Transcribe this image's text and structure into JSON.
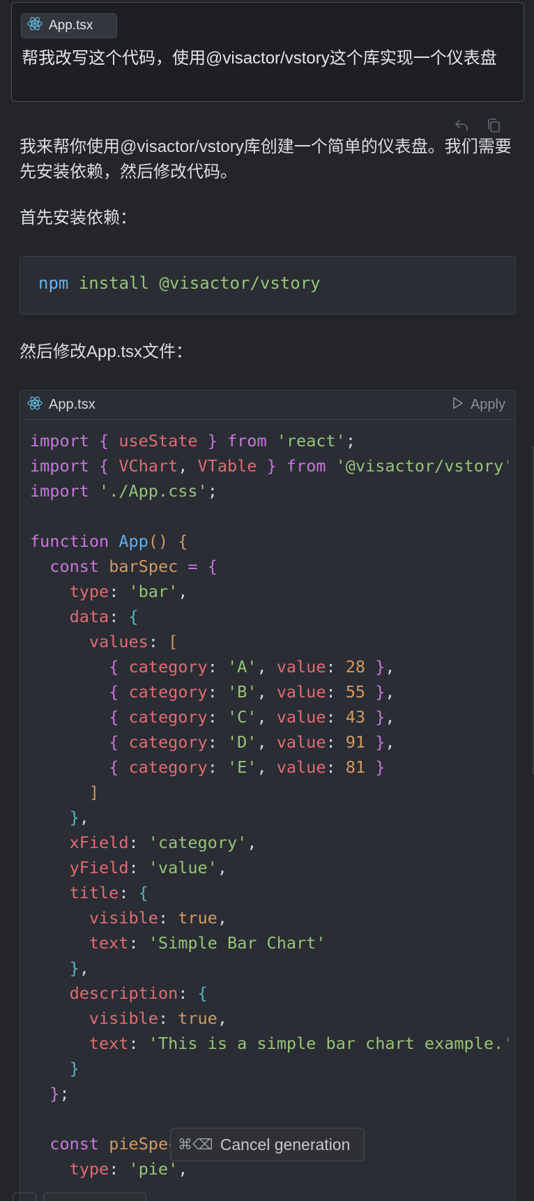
{
  "user_message": {
    "file_chip": {
      "icon": "react-icon",
      "label": "App.tsx"
    },
    "text": "帮我改写这个代码，使用@visactor/vstory这个库实现一个仪表盘"
  },
  "message_actions": {
    "icons": [
      "undo-icon",
      "copy-icon"
    ]
  },
  "response": {
    "intro": "我来帮你使用@visactor/vstory库创建一个简单的仪表盘。我们需要先安装依赖，然后修改代码。",
    "step1": "首先安装依赖：",
    "install_cmd": {
      "command": "npm",
      "args": "install @visactor/vstory"
    },
    "step2": "然后修改App.tsx文件："
  },
  "code_block": {
    "file_label": "App.tsx",
    "file_icon": "react-icon",
    "apply_label": "Apply",
    "apply_icon": "play-icon",
    "lines": [
      [
        [
          "k",
          "import"
        ],
        [
          "p",
          " "
        ],
        [
          "bp",
          "{"
        ],
        [
          "p",
          " "
        ],
        [
          "v",
          "useState"
        ],
        [
          "p",
          " "
        ],
        [
          "bp",
          "}"
        ],
        [
          "p",
          " "
        ],
        [
          "k",
          "from"
        ],
        [
          "p",
          " "
        ],
        [
          "s",
          "'react'"
        ],
        [
          "p",
          ";"
        ]
      ],
      [
        [
          "k",
          "import"
        ],
        [
          "p",
          " "
        ],
        [
          "bp",
          "{"
        ],
        [
          "p",
          " "
        ],
        [
          "v",
          "VChart"
        ],
        [
          "p",
          ", "
        ],
        [
          "v",
          "VTable"
        ],
        [
          "p",
          " "
        ],
        [
          "bp",
          "}"
        ],
        [
          "p",
          " "
        ],
        [
          "k",
          "from"
        ],
        [
          "p",
          " "
        ],
        [
          "s",
          "'@visactor/vstory'"
        ],
        [
          "p",
          ";"
        ]
      ],
      [
        [
          "k",
          "import"
        ],
        [
          "p",
          " "
        ],
        [
          "s",
          "'./App.css'"
        ],
        [
          "p",
          ";"
        ]
      ],
      [],
      [
        [
          "k",
          "function"
        ],
        [
          "p",
          " "
        ],
        [
          "f",
          "App"
        ],
        [
          "b",
          "()"
        ],
        [
          "p",
          " "
        ],
        [
          "b",
          "{"
        ]
      ],
      [
        [
          "p",
          "  "
        ],
        [
          "k",
          "const"
        ],
        [
          "p",
          " "
        ],
        [
          "n",
          "barSpec"
        ],
        [
          "p",
          " "
        ],
        [
          "k",
          "="
        ],
        [
          "p",
          " "
        ],
        [
          "bp",
          "{"
        ]
      ],
      [
        [
          "p",
          "    "
        ],
        [
          "v",
          "type"
        ],
        [
          "p",
          ": "
        ],
        [
          "s",
          "'bar'"
        ],
        [
          "p",
          ","
        ]
      ],
      [
        [
          "p",
          "    "
        ],
        [
          "v",
          "data"
        ],
        [
          "p",
          ": "
        ],
        [
          "bc",
          "{"
        ]
      ],
      [
        [
          "p",
          "      "
        ],
        [
          "v",
          "values"
        ],
        [
          "p",
          ": "
        ],
        [
          "b",
          "["
        ]
      ],
      [
        [
          "p",
          "        "
        ],
        [
          "bp",
          "{"
        ],
        [
          "p",
          " "
        ],
        [
          "v",
          "category"
        ],
        [
          "p",
          ": "
        ],
        [
          "s",
          "'A'"
        ],
        [
          "p",
          ", "
        ],
        [
          "v",
          "value"
        ],
        [
          "p",
          ": "
        ],
        [
          "n",
          "28"
        ],
        [
          "p",
          " "
        ],
        [
          "bp",
          "}"
        ],
        [
          "p",
          ","
        ]
      ],
      [
        [
          "p",
          "        "
        ],
        [
          "bp",
          "{"
        ],
        [
          "p",
          " "
        ],
        [
          "v",
          "category"
        ],
        [
          "p",
          ": "
        ],
        [
          "s",
          "'B'"
        ],
        [
          "p",
          ", "
        ],
        [
          "v",
          "value"
        ],
        [
          "p",
          ": "
        ],
        [
          "n",
          "55"
        ],
        [
          "p",
          " "
        ],
        [
          "bp",
          "}"
        ],
        [
          "p",
          ","
        ]
      ],
      [
        [
          "p",
          "        "
        ],
        [
          "bp",
          "{"
        ],
        [
          "p",
          " "
        ],
        [
          "v",
          "category"
        ],
        [
          "p",
          ": "
        ],
        [
          "s",
          "'C'"
        ],
        [
          "p",
          ", "
        ],
        [
          "v",
          "value"
        ],
        [
          "p",
          ": "
        ],
        [
          "n",
          "43"
        ],
        [
          "p",
          " "
        ],
        [
          "bp",
          "}"
        ],
        [
          "p",
          ","
        ]
      ],
      [
        [
          "p",
          "        "
        ],
        [
          "bp",
          "{"
        ],
        [
          "p",
          " "
        ],
        [
          "v",
          "category"
        ],
        [
          "p",
          ": "
        ],
        [
          "s",
          "'D'"
        ],
        [
          "p",
          ", "
        ],
        [
          "v",
          "value"
        ],
        [
          "p",
          ": "
        ],
        [
          "n",
          "91"
        ],
        [
          "p",
          " "
        ],
        [
          "bp",
          "}"
        ],
        [
          "p",
          ","
        ]
      ],
      [
        [
          "p",
          "        "
        ],
        [
          "bp",
          "{"
        ],
        [
          "p",
          " "
        ],
        [
          "v",
          "category"
        ],
        [
          "p",
          ": "
        ],
        [
          "s",
          "'E'"
        ],
        [
          "p",
          ", "
        ],
        [
          "v",
          "value"
        ],
        [
          "p",
          ": "
        ],
        [
          "n",
          "81"
        ],
        [
          "p",
          " "
        ],
        [
          "bp",
          "}"
        ]
      ],
      [
        [
          "p",
          "      "
        ],
        [
          "b",
          "]"
        ]
      ],
      [
        [
          "p",
          "    "
        ],
        [
          "bc",
          "}"
        ],
        [
          "p",
          ","
        ]
      ],
      [
        [
          "p",
          "    "
        ],
        [
          "v",
          "xField"
        ],
        [
          "p",
          ": "
        ],
        [
          "s",
          "'category'"
        ],
        [
          "p",
          ","
        ]
      ],
      [
        [
          "p",
          "    "
        ],
        [
          "v",
          "yField"
        ],
        [
          "p",
          ": "
        ],
        [
          "s",
          "'value'"
        ],
        [
          "p",
          ","
        ]
      ],
      [
        [
          "p",
          "    "
        ],
        [
          "v",
          "title"
        ],
        [
          "p",
          ": "
        ],
        [
          "bc",
          "{"
        ]
      ],
      [
        [
          "p",
          "      "
        ],
        [
          "v",
          "visible"
        ],
        [
          "p",
          ": "
        ],
        [
          "n",
          "true"
        ],
        [
          "p",
          ","
        ]
      ],
      [
        [
          "p",
          "      "
        ],
        [
          "v",
          "text"
        ],
        [
          "p",
          ": "
        ],
        [
          "s",
          "'Simple Bar Chart'"
        ]
      ],
      [
        [
          "p",
          "    "
        ],
        [
          "bc",
          "}"
        ],
        [
          "p",
          ","
        ]
      ],
      [
        [
          "p",
          "    "
        ],
        [
          "v",
          "description"
        ],
        [
          "p",
          ": "
        ],
        [
          "bc",
          "{"
        ]
      ],
      [
        [
          "p",
          "      "
        ],
        [
          "v",
          "visible"
        ],
        [
          "p",
          ": "
        ],
        [
          "n",
          "true"
        ],
        [
          "p",
          ","
        ]
      ],
      [
        [
          "p",
          "      "
        ],
        [
          "v",
          "text"
        ],
        [
          "p",
          ": "
        ],
        [
          "s",
          "'This is a simple bar chart example.'"
        ]
      ],
      [
        [
          "p",
          "    "
        ],
        [
          "bc",
          "}"
        ]
      ],
      [
        [
          "p",
          "  "
        ],
        [
          "bp",
          "}"
        ],
        [
          "p",
          ";"
        ]
      ],
      [],
      [
        [
          "p",
          "  "
        ],
        [
          "k",
          "const"
        ],
        [
          "p",
          " "
        ],
        [
          "n",
          "pieSpec"
        ],
        [
          "p",
          " "
        ],
        [
          "k",
          "="
        ],
        [
          "p",
          " "
        ],
        [
          "bp",
          "{"
        ]
      ],
      [
        [
          "p",
          "    "
        ],
        [
          "v",
          "type"
        ],
        [
          "p",
          ": "
        ],
        [
          "s",
          "'pie'"
        ],
        [
          "p",
          ","
        ]
      ]
    ]
  },
  "cancel_generation": {
    "shortcut": "⌘⌫",
    "label": "Cancel generation"
  },
  "colors": {
    "background": "#23252b",
    "keyword": "#c678dd",
    "property": "#e06c75",
    "string": "#98c379",
    "number": "#d19a66",
    "function": "#61afef",
    "react_blue": "#61c0e8"
  }
}
